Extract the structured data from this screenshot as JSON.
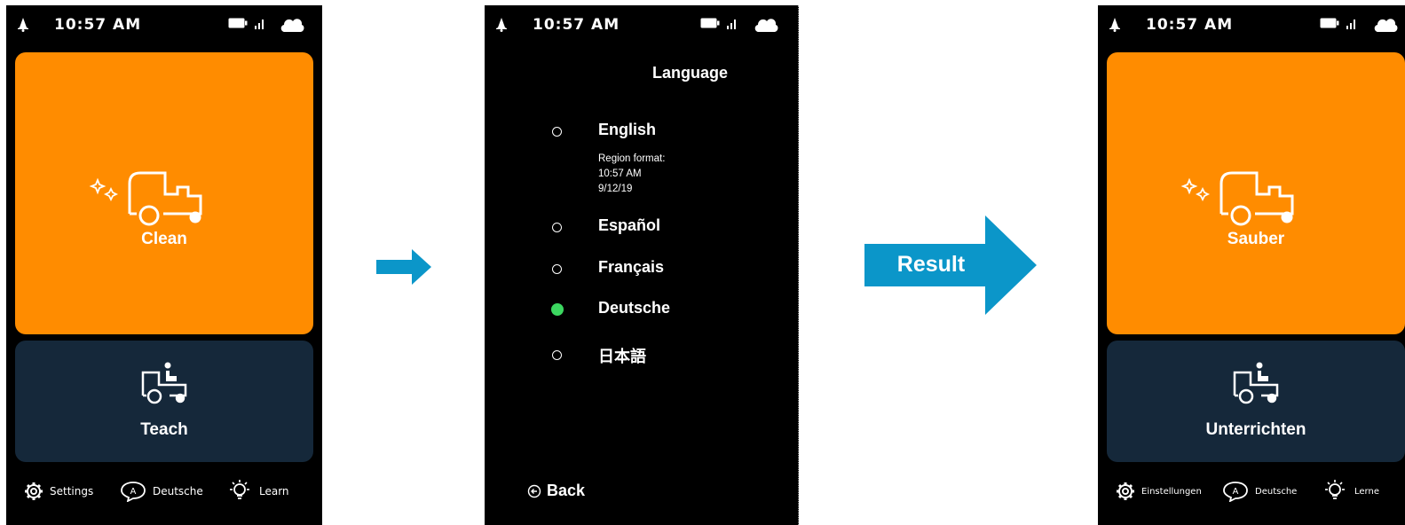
{
  "colors": {
    "clean_tile": "#ff8c00",
    "teach_tile": "#15283a",
    "arrow": "#0b96c9",
    "selected_radio": "#3cd760"
  },
  "status": {
    "time": "10:57 AM",
    "icons": [
      "bell-icon",
      "battery-icon",
      "signal-icon",
      "cloud-icon"
    ]
  },
  "left_screen": {
    "clean_label": "Clean",
    "teach_label": "Teach",
    "nav": {
      "settings": "Settings",
      "language": "Deutsche",
      "learn": "Learn"
    }
  },
  "middle_screen": {
    "title": "Language",
    "options": [
      {
        "label": "English",
        "selected": false
      },
      {
        "label": "Español",
        "selected": false
      },
      {
        "label": "Français",
        "selected": false
      },
      {
        "label": "Deutsche",
        "selected": true
      },
      {
        "label": "日本語",
        "selected": false
      }
    ],
    "region": {
      "heading": "Region format:",
      "time": "10:57 AM",
      "date": "9/12/19"
    },
    "back_label": "Back"
  },
  "result_label": "Result",
  "right_screen": {
    "clean_label": "Sauber",
    "teach_label": "Unterrichten",
    "nav": {
      "settings": "Einstellungen",
      "language": "Deutsche",
      "learn": "Lerne"
    }
  }
}
